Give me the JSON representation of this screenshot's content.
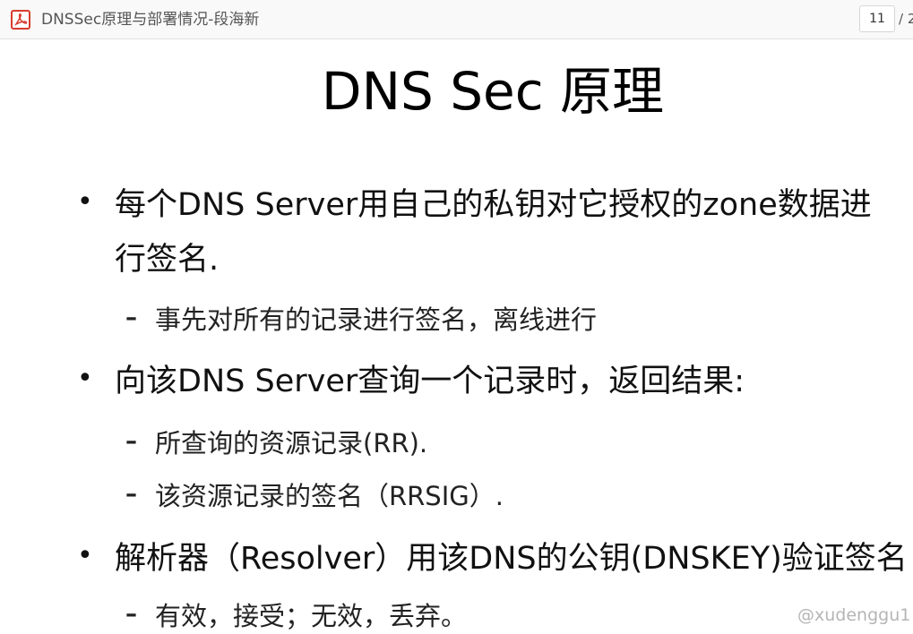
{
  "viewer": {
    "title": "DNSSec原理与部署情况-段海新",
    "page_current": "11",
    "page_total": "/ 2"
  },
  "slide": {
    "title": "DNS Sec 原理",
    "bullets": [
      {
        "lines": [
          "每个DNS Server用自己的私钥对它授权的zone数据进",
          "行签名."
        ],
        "subs": [
          "事先对所有的记录进行签名，离线进行"
        ]
      },
      {
        "lines": [
          "向该DNS Server查询一个记录时，返回结果:"
        ],
        "subs": [
          "所查询的资源记录(RR).",
          "该资源记录的签名（RRSIG）."
        ]
      },
      {
        "lines": [
          "解析器（Resolver）用该DNS的公钥(DNSKEY)验证签名"
        ],
        "subs": [
          "有效，接受；无效，丢弃。"
        ]
      }
    ],
    "bullet_symbol": "•",
    "sub_bullet_symbol": "–",
    "watermark": "@xudenggu1"
  },
  "icons": {
    "pdf": "pdf-file-icon"
  },
  "colors": {
    "pdf_icon": "#d83b2d",
    "toolbar_bg": "#f9f9f9"
  }
}
